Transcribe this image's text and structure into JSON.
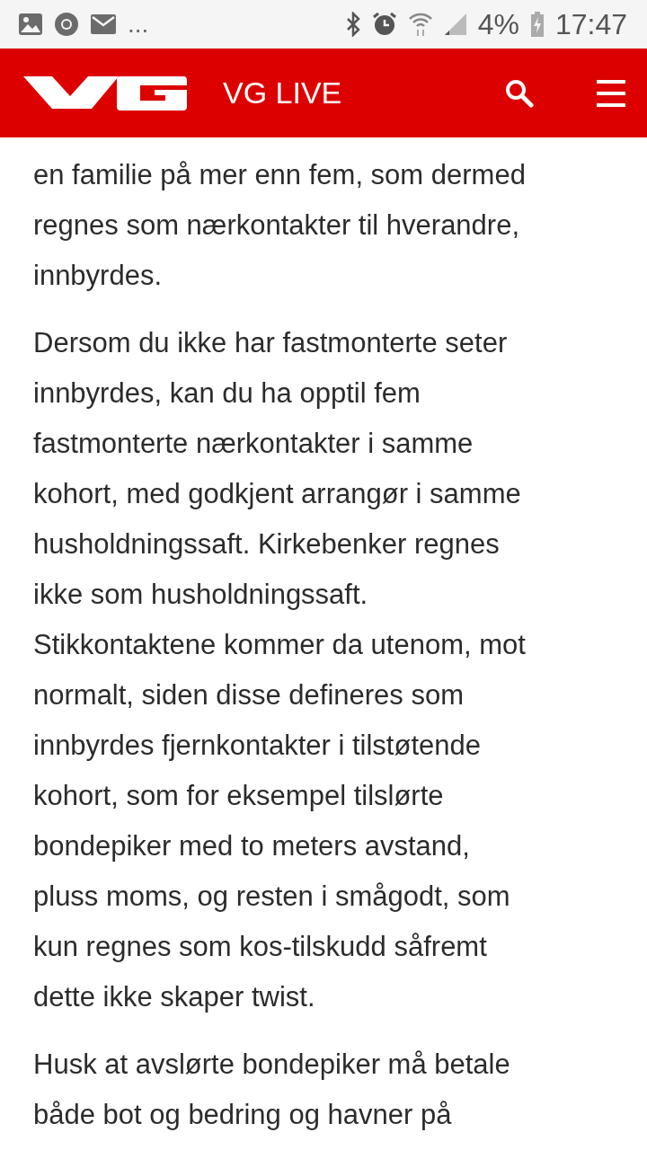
{
  "status_bar": {
    "more": "...",
    "battery": "4%",
    "time": "17:47"
  },
  "header": {
    "title": "VG LIVE"
  },
  "article": {
    "paragraphs": [
      {
        "lines": [
          "en familie på mer enn fem, som dermed",
          "regnes som nærkontakter til hverandre,",
          "innbyrdes."
        ]
      },
      {
        "lines": [
          "Dersom du ikke har fastmonterte seter",
          "innbyrdes, kan du ha opptil fem",
          "fastmonterte nærkontakter i samme",
          "kohort, med godkjent arrangør i samme",
          "husholdningssaft. Kirkebenker regnes",
          "ikke som husholdningssaft.",
          "Stikkontaktene kommer da utenom, mot",
          "normalt, siden disse defineres som",
          "innbyrdes fjernkontakter i tilstøtende",
          "kohort, som for eksempel tilslørte",
          "bondepiker med to meters avstand,",
          "pluss moms, og resten i smågodt, som",
          "kun regnes som kos-tilskudd såfremt",
          "dette ikke skaper twist."
        ]
      },
      {
        "lines": [
          "Husk at avslørte bondepiker må betale",
          "både bot og bedring og havner på"
        ]
      }
    ]
  }
}
